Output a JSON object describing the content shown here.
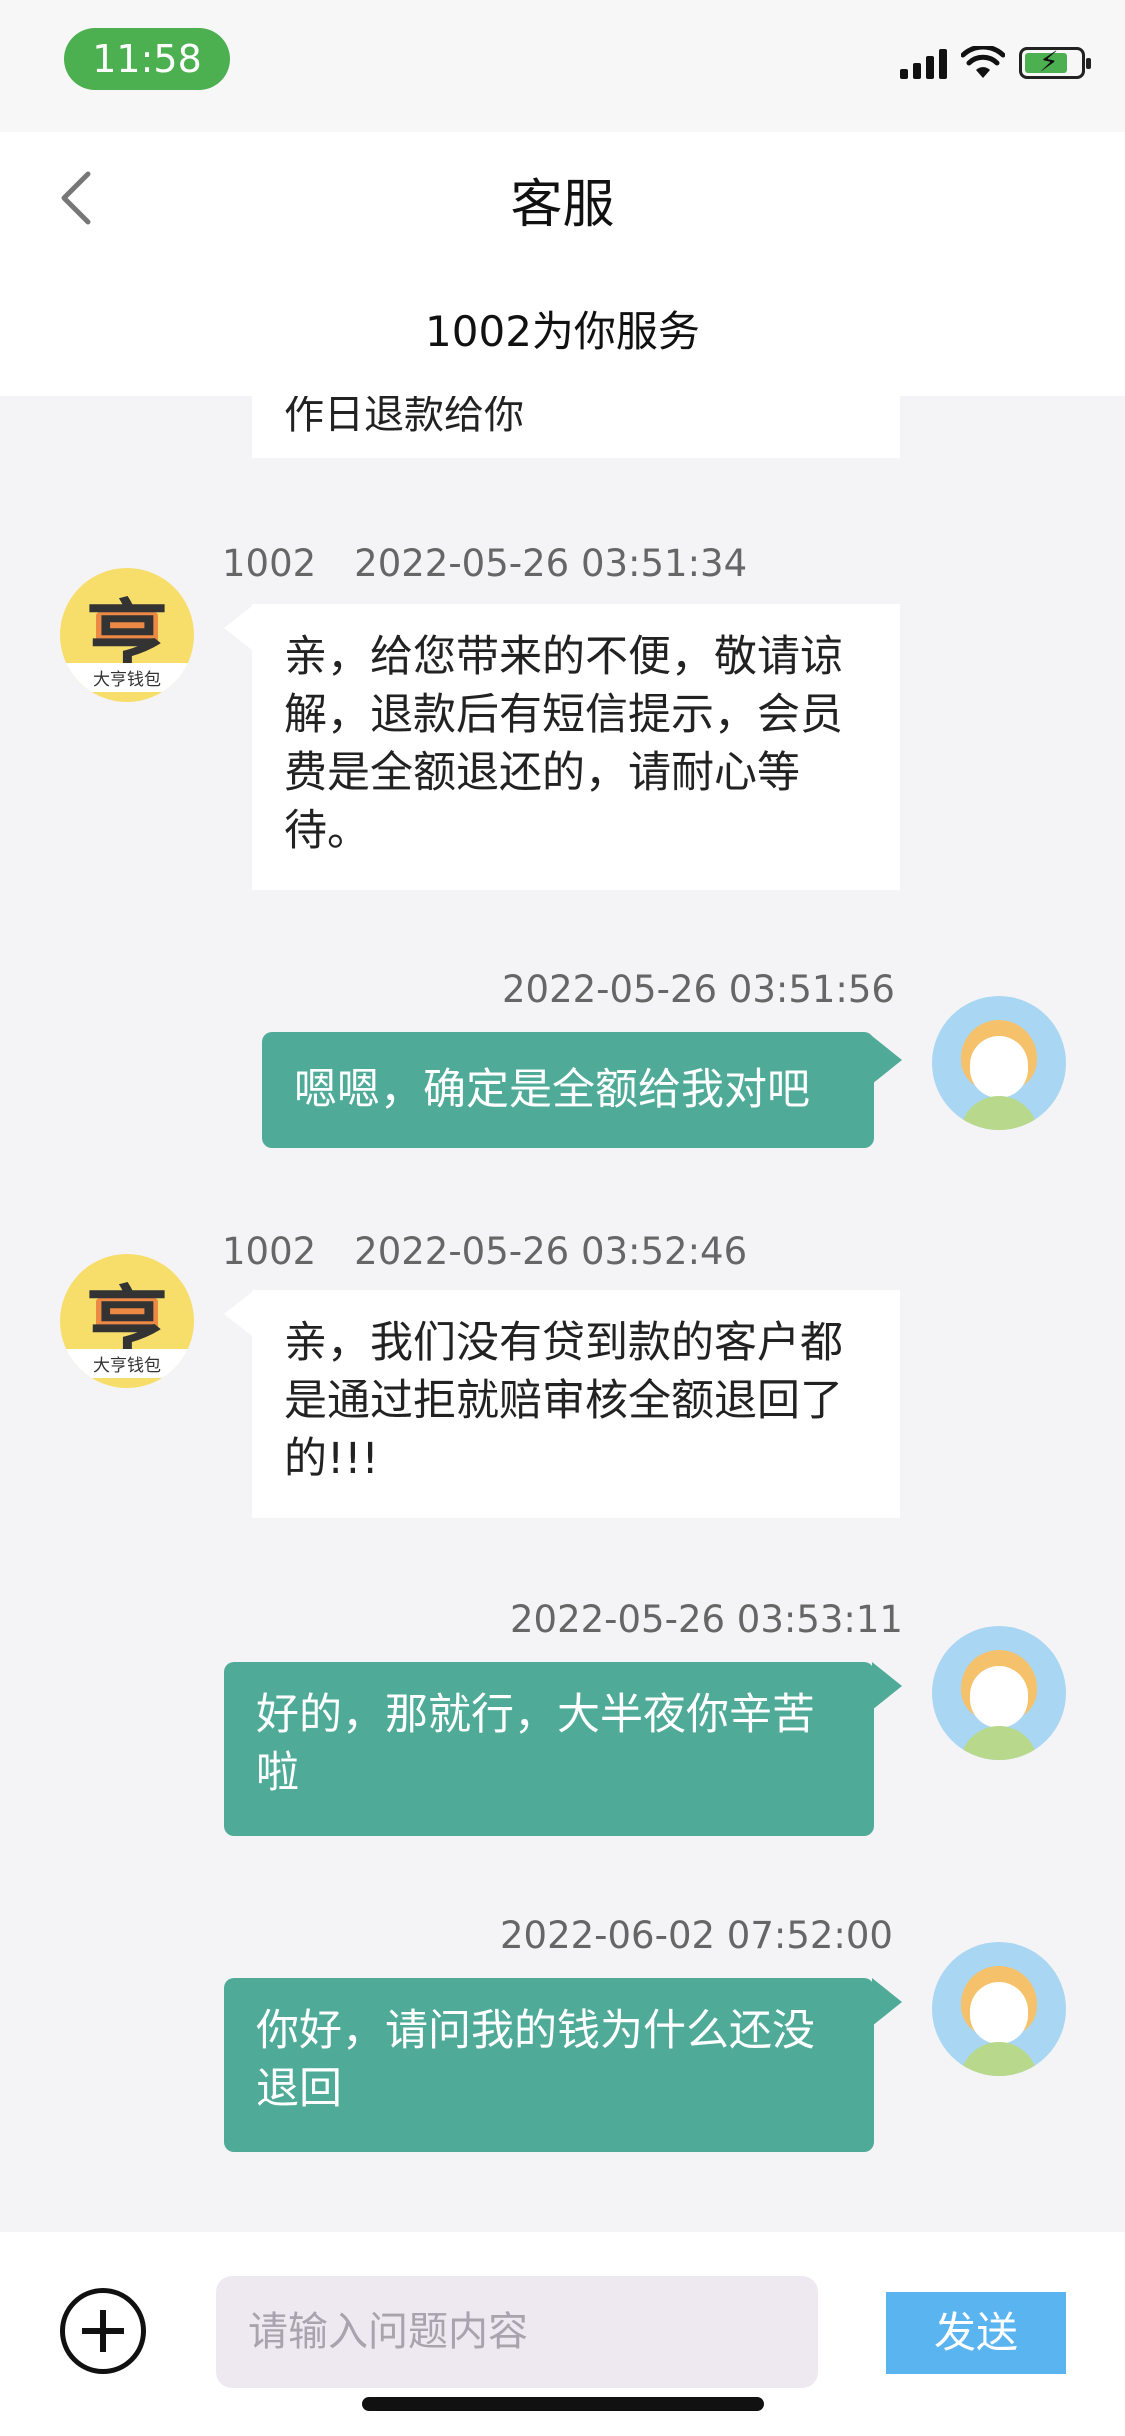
{
  "status_bar": {
    "time": "11:58"
  },
  "header": {
    "title": "客服",
    "subtitle": "1002为你服务"
  },
  "chat": {
    "partial_previous": "作日退款给你",
    "messages": [
      {
        "side": "in",
        "agent_id": "1002",
        "timestamp": "2022-05-26 03:51:34",
        "text": "亲，给您带来的不便，敬请谅解，退款后有短信提示，会员费是全额退还的，请耐心等待。"
      },
      {
        "side": "out",
        "timestamp": "2022-05-26 03:51:56",
        "text": "嗯嗯，确定是全额给我对吧"
      },
      {
        "side": "in",
        "agent_id": "1002",
        "timestamp": "2022-05-26 03:52:46",
        "text": "亲，我们没有贷到款的客户都是通过拒就赔审核全额退回了的!!!"
      },
      {
        "side": "out",
        "timestamp": "2022-05-26 03:53:11",
        "text": "好的，那就行，大半夜你辛苦啦"
      },
      {
        "side": "out",
        "timestamp": "2022-06-02 07:52:00",
        "text": "你好，请问我的钱为什么还没退回"
      }
    ],
    "agent_avatar": {
      "char": "亨",
      "brand": "大亨钱包"
    }
  },
  "composer": {
    "placeholder": "请输入问题内容",
    "send_label": "发送"
  },
  "colors": {
    "outgoing_bubble": "#4fab98",
    "send_button": "#5ab4f0",
    "time_pill": "#4caf50"
  }
}
